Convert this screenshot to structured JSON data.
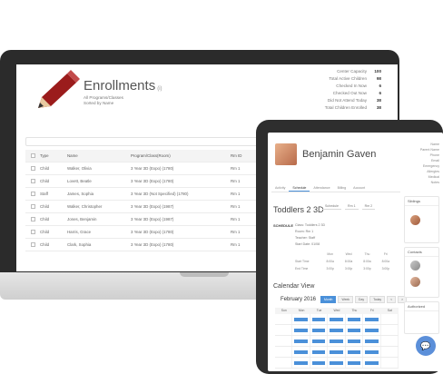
{
  "enrollments": {
    "title": "Enrollments",
    "title_sup": "(i)",
    "subtitle_1": "All Programs/Classes",
    "subtitle_2": "Sorted by Name",
    "stats": [
      {
        "label": "Center Capacity",
        "value": "100"
      },
      {
        "label": "Total Active Children",
        "value": "98"
      },
      {
        "label": "Checked In Now",
        "value": "6"
      },
      {
        "label": "Checked Out Now",
        "value": "6"
      },
      {
        "label": "Did Not Attend Today",
        "value": "38"
      },
      {
        "label": "Total Children Enrolled",
        "value": "38"
      }
    ],
    "search_icon": "search-icon",
    "columns": [
      "",
      "Type",
      "Name",
      "Program/Class(Room)",
      "Rm ID"
    ],
    "rows": [
      {
        "type": "Child",
        "name": "Walker, Olivia",
        "program": "3 Year 3D (Expo) (1780)",
        "rm": "Rm 1"
      },
      {
        "type": "Child",
        "name": "Lovett, Beatle",
        "program": "3 Year 3D (Expo) (1780)",
        "rm": "Rm 1"
      },
      {
        "type": "Staff",
        "name": "James, Sophia",
        "program": "3 Year 3D (Not Specified) (1780)",
        "rm": "Rm 1"
      },
      {
        "type": "Child",
        "name": "Walker, Christopher",
        "program": "3 Year 3D (Expo) (1987)",
        "rm": "Rm 1"
      },
      {
        "type": "Child",
        "name": "Jones, Benjamin",
        "program": "3 Year 3D (Expo) (1987)",
        "rm": "Rm 1"
      },
      {
        "type": "Child",
        "name": "Harris, Grace",
        "program": "3 Year 3D (Expo) (1780)",
        "rm": "Rm 1"
      },
      {
        "type": "Child",
        "name": "Clark, Sophia",
        "program": "3 Year 3D (Expo) (1780)",
        "rm": "Rm 1"
      }
    ]
  },
  "profile": {
    "name": "Benjamin Gaven",
    "meta": [
      "Name",
      "Parent Name",
      "Phone",
      "Email",
      "Emergency",
      "Allergies",
      "Medical",
      "Notes"
    ],
    "tabs": [
      "Activity",
      "Schedule",
      "Attendance",
      "Billing",
      "Account"
    ],
    "active_tab": "Schedule",
    "class_name": "Toddlers 2 3D",
    "class_tabs": [
      "Schedule",
      "Rm 1",
      "Rm 2"
    ],
    "schedule_label": "SCHEDULE",
    "info": [
      "Class: Toddlers 2 3D",
      "Room: Rm 1",
      "Teacher: Staff",
      "Start Date: 01/08"
    ],
    "mini_head": [
      "",
      "Mon",
      "Wed",
      "Thu",
      "Fri"
    ],
    "mini_rows": [
      [
        "Start Time",
        "8:00a",
        "8:00a",
        "8:00a",
        "8:00a"
      ],
      [
        "End Time",
        "3:00p",
        "3:00p",
        "3:00p",
        "3:00p"
      ]
    ],
    "calendar_title": "Calendar View",
    "month": "February 2016",
    "cal_buttons": [
      "Month",
      "Week",
      "Day",
      "Today",
      "<",
      ">"
    ],
    "weekdays": [
      "Sun",
      "Mon",
      "Tue",
      "Wed",
      "Thu",
      "Fri",
      "Sat"
    ],
    "weeks": [
      [
        0,
        1,
        1,
        1,
        1,
        1,
        0
      ],
      [
        0,
        1,
        1,
        1,
        1,
        1,
        0
      ],
      [
        0,
        1,
        1,
        1,
        1,
        1,
        0
      ],
      [
        0,
        1,
        1,
        1,
        1,
        1,
        0
      ],
      [
        0,
        1,
        1,
        1,
        1,
        1,
        0
      ]
    ],
    "side": [
      {
        "title": "Siblings"
      },
      {
        "title": "Contacts"
      },
      {
        "title": "Authorized"
      }
    ],
    "chat_icon": "chat-icon",
    "colors": {
      "accent": "#4a90d9",
      "pencil": "#9b1c1c"
    }
  }
}
